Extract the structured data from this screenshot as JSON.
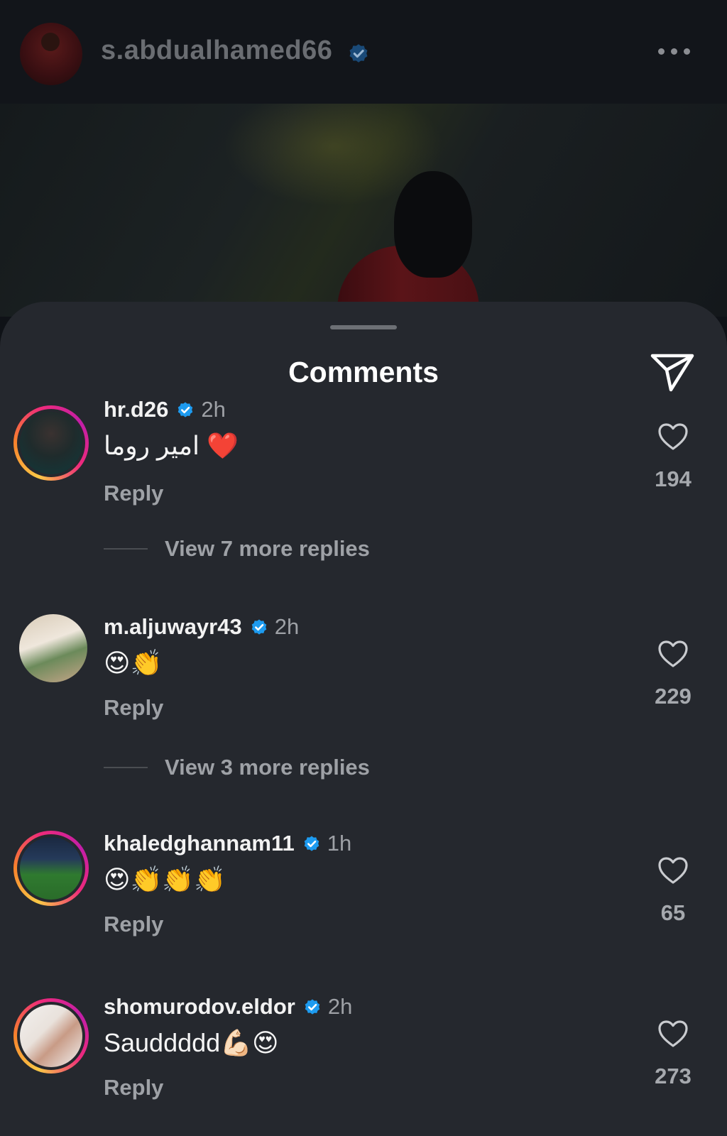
{
  "post": {
    "username": "s.abdualhamed66",
    "verified": true
  },
  "sheet": {
    "title": "Comments"
  },
  "comments": [
    {
      "username": "hr.d26",
      "timestamp": "2h",
      "text": "امير روما ❤️",
      "reply_label": "Reply",
      "likes": "194",
      "view_replies": "View 7 more replies"
    },
    {
      "username": "m.aljuwayr43",
      "timestamp": "2h",
      "text": "😍👏",
      "reply_label": "Reply",
      "likes": "229",
      "view_replies": "View 3 more replies"
    },
    {
      "username": "khaledghannam11",
      "timestamp": "1h",
      "text": "😍👏👏👏",
      "reply_label": "Reply",
      "likes": "65"
    },
    {
      "username": "shomurodov.eldor",
      "timestamp": "2h",
      "text": "Sauddddd💪🏻😍",
      "reply_label": "Reply",
      "likes": "273"
    }
  ],
  "colors": {
    "verified_blue": "#1d9bf0",
    "sheet_bg": "#25282e",
    "muted_text": "#9ea1a6"
  },
  "icons": [
    "verified-badge-icon",
    "more-options-icon",
    "share-icon",
    "heart-icon"
  ]
}
